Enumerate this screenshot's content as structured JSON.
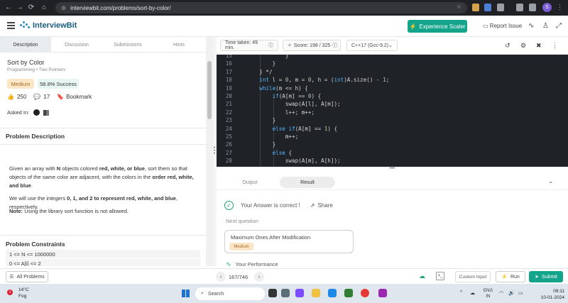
{
  "browser": {
    "url": "interviewbit.com/problems/sort-by-color/",
    "profile_initial": "S"
  },
  "header": {
    "brand": "InterviewBit",
    "experience_button": "Experience Scaler",
    "report_issue": "Report Issue"
  },
  "left_tabs": [
    "Description",
    "Discussion",
    "Submissions",
    "Hints"
  ],
  "problem": {
    "title": "Sort by Color",
    "tags": "Programming • Two Pointers",
    "difficulty": "Medium",
    "success": "58.8% Success",
    "likes": "250",
    "comments": "17",
    "bookmark": "Bookmark",
    "asked_in": "Asked In:",
    "description_title": "Problem Description",
    "desc_p1_a": "Given an array with ",
    "desc_p1_N": "N",
    "desc_p1_b": " objects colored ",
    "desc_p1_colors": "red, white, or blue",
    "desc_p1_c": ", sort them so that objects of the same color are adjacent, with the colors in the ",
    "desc_p1_order": "order red, white, and blue",
    "desc_p1_d": ".",
    "desc_p2_a": "We will use the integers ",
    "desc_p2_ints": "0, 1, and 2 to represent red, white, and blue",
    "desc_p2_b": ", respectively.",
    "desc_p3_a": "Note:",
    "desc_p3_b": " Using the library sort function is not allowed.",
    "constraints_title": "Problem Constraints",
    "constraints": [
      "1 <= N <= 1000000",
      "0 <= A[i] <= 2"
    ]
  },
  "editor": {
    "time_taken": "Time taken: 49 min.",
    "score_label": "Score:",
    "score_value": "198",
    "score_total": "325",
    "language": "C++17 (Gcc-9.2)",
    "code_lines": [
      {
        "n": "15",
        "text": "            }"
      },
      {
        "n": "16",
        "text": "        }"
      },
      {
        "n": "17",
        "text": "    } */"
      },
      {
        "n": "18",
        "text": "    int l = 0, m = 0, h = (int)A.size() - 1;"
      },
      {
        "n": "19",
        "text": "    while(m <= h) {"
      },
      {
        "n": "20",
        "text": "        if(A[m] == 0) {"
      },
      {
        "n": "21",
        "text": "            swap(A[l], A[m]);"
      },
      {
        "n": "22",
        "text": "            l++; m++;"
      },
      {
        "n": "23",
        "text": "        }"
      },
      {
        "n": "24",
        "text": "        else if(A[m] == 1) {"
      },
      {
        "n": "25",
        "text": "            m++;"
      },
      {
        "n": "26",
        "text": "        }"
      },
      {
        "n": "27",
        "text": "        else {"
      },
      {
        "n": "28",
        "text": "            swap(A[m], A[h]);"
      }
    ]
  },
  "output": {
    "tabs": [
      "Output",
      "Result"
    ],
    "result_text": "Your Answer is correct !",
    "share": "Share",
    "next_question": "Next question",
    "next_title": "Maximum Ones After Modification",
    "next_difficulty": "Medium",
    "performance": "Your Performance"
  },
  "bottom": {
    "all_problems": "All Problems",
    "page": "167/746",
    "custom_input": "Custom Input",
    "run": "Run",
    "submit": "Submit"
  },
  "taskbar": {
    "temp": "14°C",
    "weather": "Fog",
    "weather_badge": "1",
    "search": "Search",
    "lang": "ENG",
    "region": "IN",
    "time": "09:11",
    "date": "10-01-2024"
  },
  "colors": {
    "accent": "#14a38b",
    "code_bg": "#1f2227",
    "keyword": "#56b6ff",
    "difficulty_bg": "#fde5c8",
    "success_bg": "#e7f6f2"
  }
}
